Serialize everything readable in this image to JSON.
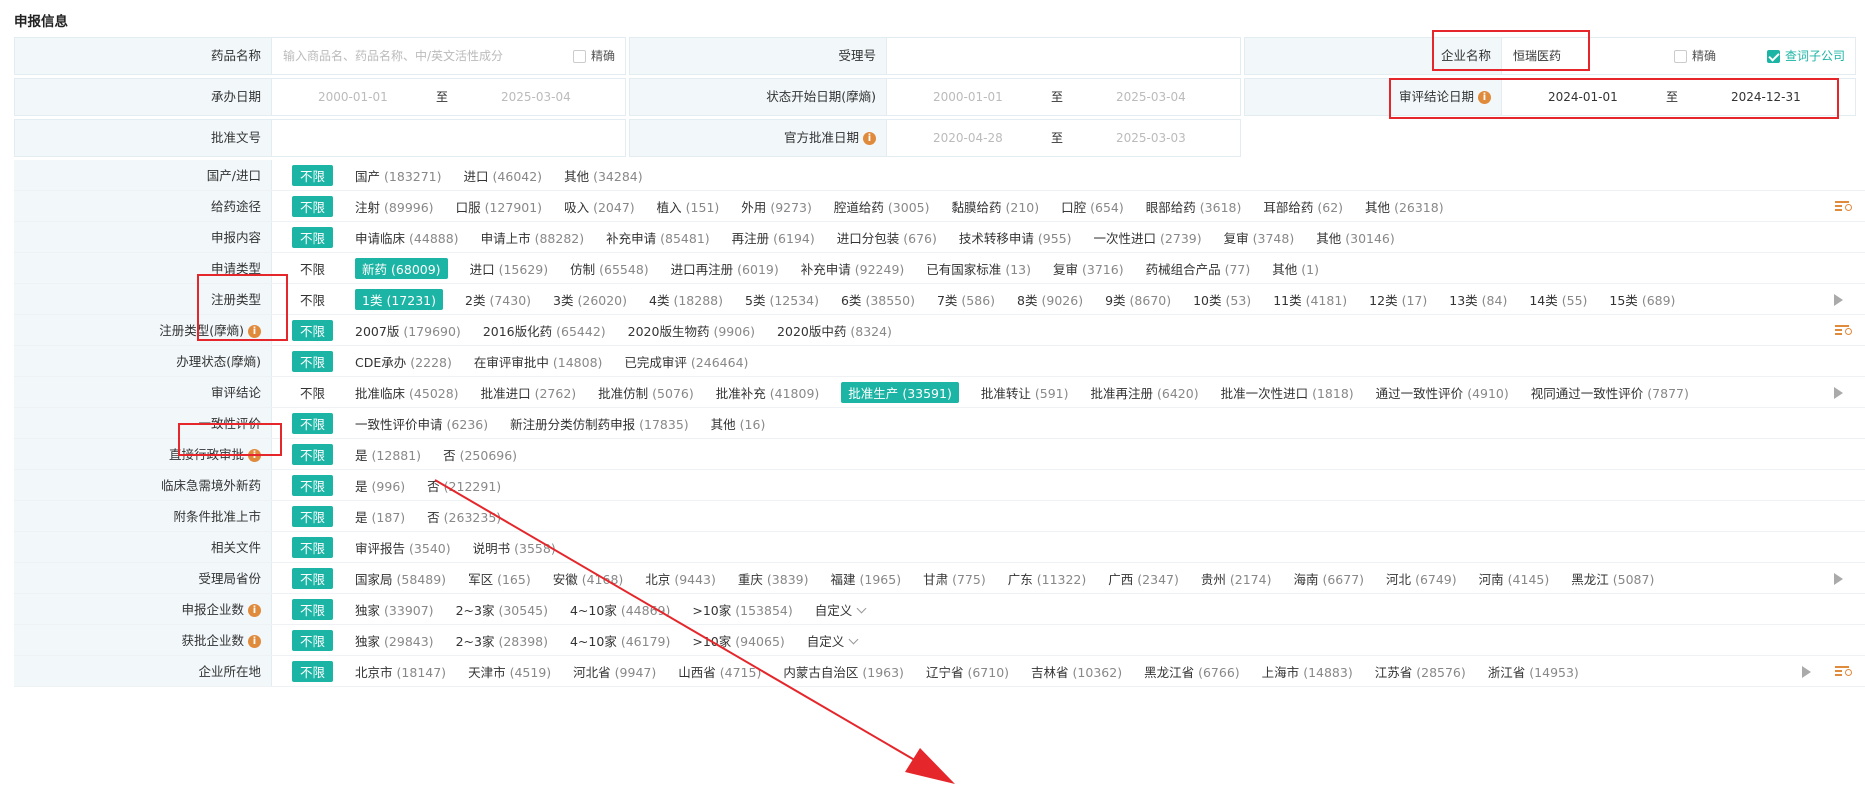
{
  "section_title": "申报信息",
  "form": {
    "drug_name_label": "药品名称",
    "drug_name_placeholder": "输入商品名、药品名称、中/英文活性成分",
    "exact_label": "精确",
    "acceptance_no_label": "受理号",
    "company_label": "企业名称",
    "company_value": "恒瑞医药",
    "query_subsidiary_label": "查词子公司",
    "handle_date_label": "承办日期",
    "handle_date_from": "2000-01-01",
    "handle_date_to": "2025-03-04",
    "status_start_label": "状态开始日期(摩熵)",
    "status_start_from": "2000-01-01",
    "status_start_to": "2025-03-04",
    "review_date_label": "审评结论日期",
    "review_date_from": "2024-01-01",
    "review_date_to": "2024-12-31",
    "approval_no_label": "批准文号",
    "official_date_label": "官方批准日期",
    "official_date_from": "2020-04-28",
    "official_date_to": "2025-03-03",
    "to_label": "至"
  },
  "filters": [
    {
      "label": "国产/进口",
      "nolimit": "不限",
      "nolimit_selected": true,
      "options": [
        {
          "t": "国产",
          "n": "(183271)"
        },
        {
          "t": "进口",
          "n": "(46042)"
        },
        {
          "t": "其他",
          "n": "(34284)"
        }
      ]
    },
    {
      "label": "给药途径",
      "nolimit": "不限",
      "nolimit_selected": true,
      "options": [
        {
          "t": "注射",
          "n": "(89996)"
        },
        {
          "t": "口服",
          "n": "(127901)"
        },
        {
          "t": "吸入",
          "n": "(2047)"
        },
        {
          "t": "植入",
          "n": "(151)"
        },
        {
          "t": "外用",
          "n": "(9273)"
        },
        {
          "t": "腔道给药",
          "n": "(3005)"
        },
        {
          "t": "黏膜给药",
          "n": "(210)"
        },
        {
          "t": "口腔",
          "n": "(654)"
        },
        {
          "t": "眼部给药",
          "n": "(3618)"
        },
        {
          "t": "耳部给药",
          "n": "(62)"
        },
        {
          "t": "其他",
          "n": "(26318)"
        }
      ]
    },
    {
      "label": "申报内容",
      "nolimit": "不限",
      "nolimit_selected": true,
      "options": [
        {
          "t": "申请临床",
          "n": "(44888)"
        },
        {
          "t": "申请上市",
          "n": "(88282)"
        },
        {
          "t": "补充申请",
          "n": "(85481)"
        },
        {
          "t": "再注册",
          "n": "(6194)"
        },
        {
          "t": "进口分包装",
          "n": "(676)"
        },
        {
          "t": "技术转移申请",
          "n": "(955)"
        },
        {
          "t": "一次性进口",
          "n": "(2739)"
        },
        {
          "t": "复审",
          "n": "(3748)"
        },
        {
          "t": "其他",
          "n": "(30146)"
        }
      ]
    },
    {
      "label": "申请类型",
      "nolimit": "不限",
      "nolimit_selected": false,
      "options": [
        {
          "t": "新药",
          "n": "(68009)",
          "sel": true
        },
        {
          "t": "进口",
          "n": "(15629)"
        },
        {
          "t": "仿制",
          "n": "(65548)"
        },
        {
          "t": "进口再注册",
          "n": "(6019)"
        },
        {
          "t": "补充申请",
          "n": "(92249)"
        },
        {
          "t": "已有国家标准",
          "n": "(13)"
        },
        {
          "t": "复审",
          "n": "(3716)"
        },
        {
          "t": "药械组合产品",
          "n": "(77)"
        },
        {
          "t": "其他",
          "n": "(1)"
        }
      ]
    },
    {
      "label": "注册类型",
      "nolimit": "不限",
      "nolimit_selected": false,
      "options": [
        {
          "t": "1类",
          "n": "(17231)",
          "sel": true
        },
        {
          "t": "2类",
          "n": "(7430)"
        },
        {
          "t": "3类",
          "n": "(26020)"
        },
        {
          "t": "4类",
          "n": "(18288)"
        },
        {
          "t": "5类",
          "n": "(12534)"
        },
        {
          "t": "6类",
          "n": "(38550)"
        },
        {
          "t": "7类",
          "n": "(586)"
        },
        {
          "t": "8类",
          "n": "(9026)"
        },
        {
          "t": "9类",
          "n": "(8670)"
        },
        {
          "t": "10类",
          "n": "(53)"
        },
        {
          "t": "11类",
          "n": "(4181)"
        },
        {
          "t": "12类",
          "n": "(17)"
        },
        {
          "t": "13类",
          "n": "(84)"
        },
        {
          "t": "14类",
          "n": "(55)"
        },
        {
          "t": "15类",
          "n": "(689)"
        }
      ]
    },
    {
      "label": "注册类型(摩熵)",
      "nolimit": "不限",
      "nolimit_selected": true,
      "options": [
        {
          "t": "2007版",
          "n": "(179690)"
        },
        {
          "t": "2016版化药",
          "n": "(65442)"
        },
        {
          "t": "2020版生物药",
          "n": "(9906)"
        },
        {
          "t": "2020版中药",
          "n": "(8324)"
        }
      ]
    },
    {
      "label": "办理状态(摩熵)",
      "nolimit": "不限",
      "nolimit_selected": true,
      "options": [
        {
          "t": "CDE承办",
          "n": "(2228)"
        },
        {
          "t": "在审评审批中",
          "n": "(14808)"
        },
        {
          "t": "已完成审评",
          "n": "(246464)"
        }
      ]
    },
    {
      "label": "审评结论",
      "nolimit": "不限",
      "nolimit_selected": false,
      "options": [
        {
          "t": "批准临床",
          "n": "(45028)"
        },
        {
          "t": "批准进口",
          "n": "(2762)"
        },
        {
          "t": "批准仿制",
          "n": "(5076)"
        },
        {
          "t": "批准补充",
          "n": "(41809)"
        },
        {
          "t": "批准生产",
          "n": "(33591)",
          "sel": true
        },
        {
          "t": "批准转让",
          "n": "(591)"
        },
        {
          "t": "批准再注册",
          "n": "(6420)"
        },
        {
          "t": "批准一次性进口",
          "n": "(1818)"
        },
        {
          "t": "通过一致性评价",
          "n": "(4910)"
        },
        {
          "t": "视同通过一致性评价",
          "n": "(7877)"
        }
      ]
    },
    {
      "label": "一致性评价",
      "nolimit": "不限",
      "nolimit_selected": true,
      "options": [
        {
          "t": "一致性评价申请",
          "n": "(6236)"
        },
        {
          "t": "新注册分类仿制药申报",
          "n": "(17835)"
        },
        {
          "t": "其他",
          "n": "(16)"
        }
      ]
    },
    {
      "label": "直接行政审批",
      "nolimit": "不限",
      "nolimit_selected": true,
      "options": [
        {
          "t": "是",
          "n": "(12881)"
        },
        {
          "t": "否",
          "n": "(250696)"
        }
      ]
    },
    {
      "label": "临床急需境外新药",
      "nolimit": "不限",
      "nolimit_selected": true,
      "options": [
        {
          "t": "是",
          "n": "(996)"
        },
        {
          "t": "否",
          "n": "(212291)"
        }
      ]
    },
    {
      "label": "附条件批准上市",
      "nolimit": "不限",
      "nolimit_selected": true,
      "options": [
        {
          "t": "是",
          "n": "(187)"
        },
        {
          "t": "否",
          "n": "(263235)"
        }
      ]
    },
    {
      "label": "相关文件",
      "nolimit": "不限",
      "nolimit_selected": true,
      "options": [
        {
          "t": "审评报告",
          "n": "(3540)"
        },
        {
          "t": "说明书",
          "n": "(3558)"
        }
      ]
    },
    {
      "label": "受理局省份",
      "nolimit": "不限",
      "nolimit_selected": true,
      "options": [
        {
          "t": "国家局",
          "n": "(58489)"
        },
        {
          "t": "军区",
          "n": "(165)"
        },
        {
          "t": "安徽",
          "n": "(4168)"
        },
        {
          "t": "北京",
          "n": "(9443)"
        },
        {
          "t": "重庆",
          "n": "(3839)"
        },
        {
          "t": "福建",
          "n": "(1965)"
        },
        {
          "t": "甘肃",
          "n": "(775)"
        },
        {
          "t": "广东",
          "n": "(11322)"
        },
        {
          "t": "广西",
          "n": "(2347)"
        },
        {
          "t": "贵州",
          "n": "(2174)"
        },
        {
          "t": "海南",
          "n": "(6677)"
        },
        {
          "t": "河北",
          "n": "(6749)"
        },
        {
          "t": "河南",
          "n": "(4145)"
        },
        {
          "t": "黑龙江",
          "n": "(5087)"
        }
      ]
    },
    {
      "label": "申报企业数",
      "nolimit": "不限",
      "nolimit_selected": true,
      "options": [
        {
          "t": "独家",
          "n": "(33907)"
        },
        {
          "t": "2~3家",
          "n": "(30545)"
        },
        {
          "t": "4~10家",
          "n": "(44869)"
        },
        {
          "t": ">10家",
          "n": "(153854)"
        }
      ],
      "custom": "自定义"
    },
    {
      "label": "获批企业数",
      "nolimit": "不限",
      "nolimit_selected": true,
      "options": [
        {
          "t": "独家",
          "n": "(29843)"
        },
        {
          "t": "2~3家",
          "n": "(28398)"
        },
        {
          "t": "4~10家",
          "n": "(46179)"
        },
        {
          "t": ">10家",
          "n": "(94065)"
        }
      ],
      "custom": "自定义"
    },
    {
      "label": "企业所在地",
      "nolimit": "不限",
      "nolimit_selected": true,
      "options": [
        {
          "t": "北京市",
          "n": "(18147)"
        },
        {
          "t": "天津市",
          "n": "(4519)"
        },
        {
          "t": "河北省",
          "n": "(9947)"
        },
        {
          "t": "山西省",
          "n": "(4715)"
        },
        {
          "t": "内蒙古自治区",
          "n": "(1963)"
        },
        {
          "t": "辽宁省",
          "n": "(6710)"
        },
        {
          "t": "吉林省",
          "n": "(10362)"
        },
        {
          "t": "黑龙江省",
          "n": "(6766)"
        },
        {
          "t": "上海市",
          "n": "(14883)"
        },
        {
          "t": "江苏省",
          "n": "(28576)"
        },
        {
          "t": "浙江省",
          "n": "(14953)"
        }
      ]
    }
  ],
  "colors": {
    "accent": "#1cb4a4",
    "highlight": "#e5262b",
    "info": "#e08a3c"
  }
}
